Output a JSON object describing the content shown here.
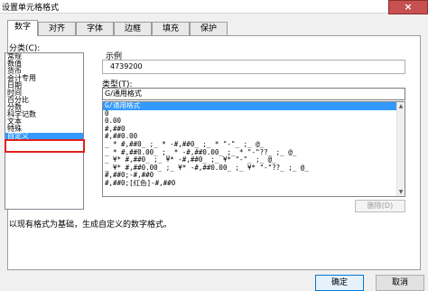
{
  "window": {
    "title": "设置单元格格式",
    "close": "×"
  },
  "tabs": [
    "数字",
    "对齐",
    "字体",
    "边框",
    "填充",
    "保护"
  ],
  "category": {
    "label": "分类(C):",
    "items": [
      "常规",
      "数值",
      "货币",
      "会计专用",
      "日期",
      "时间",
      "百分比",
      "分数",
      "科学记数",
      "文本",
      "特殊",
      "自定义"
    ],
    "selected_index": 11
  },
  "sample": {
    "label": "示例",
    "value": "4739200"
  },
  "type": {
    "label": "类型(T):",
    "input_value": "G/通用格式",
    "items": [
      "G/通用格式",
      "0",
      "0.00",
      "#,##0",
      "#,##0.00",
      "_ * #,##0_ ;_ * -#,##0_ ;_ * \"-\"_ ;_ @_",
      "_ * #,##0.00_ ;_ * -#,##0.00_ ;_ * \"-\"??_ ;_ @_",
      "_ ¥* #,##0_ ;_ ¥* -#,##0_ ;_ ¥* \"-\"_ ;_ @_",
      "_ ¥* #,##0.00_ ;_ ¥* -#,##0.00_ ;_ ¥* \"-\"??_ ;_ @_",
      "#,##0;-#,##0",
      "#,##0;[红色]-#,##0"
    ],
    "selected_index": 0
  },
  "delete_button": "删除(D)",
  "description": "以现有格式为基础，生成自定义的数字格式。",
  "ok_button": "确定",
  "cancel_button": "取消"
}
